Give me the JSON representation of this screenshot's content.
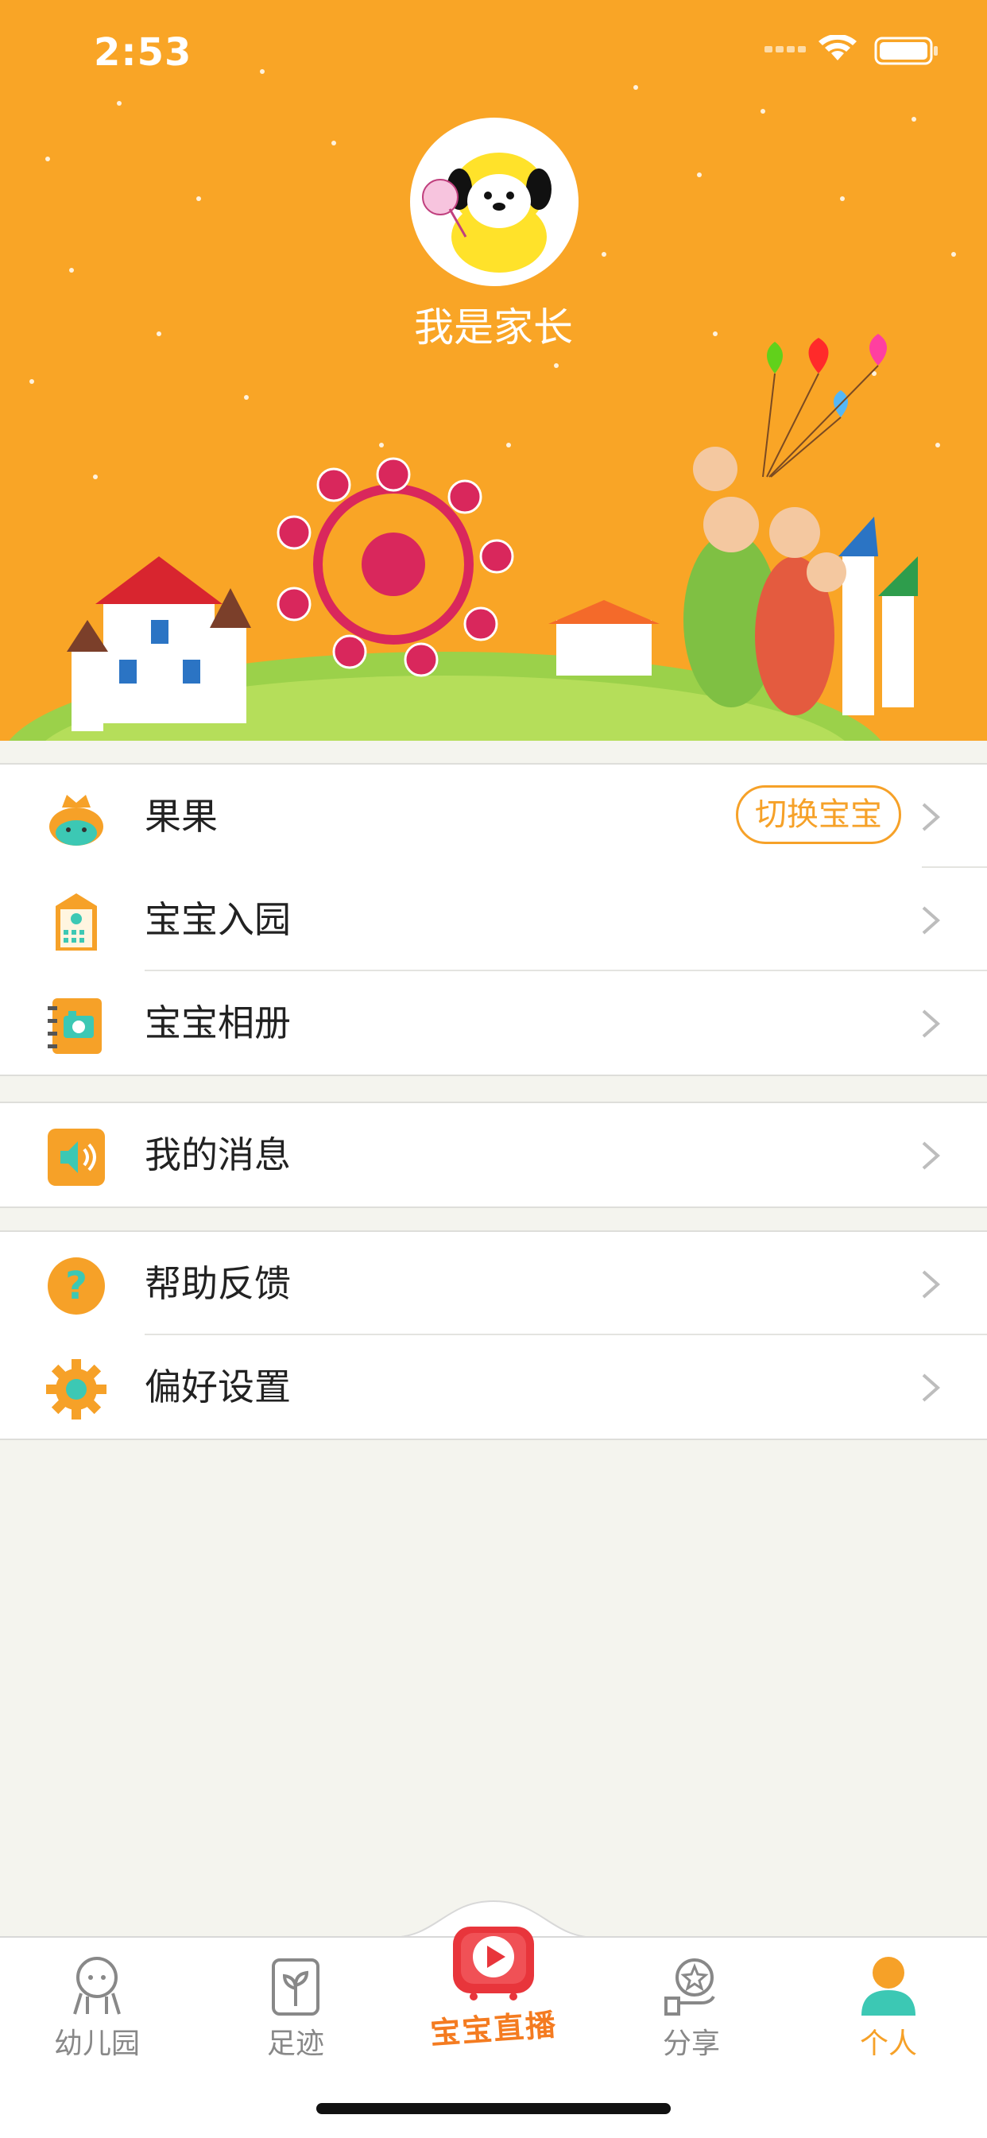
{
  "status_bar": {
    "time": "2:53"
  },
  "profile": {
    "username": "我是家长"
  },
  "menu": {
    "child": {
      "label": "果果",
      "switch_label": "切换宝宝"
    },
    "enroll": {
      "label": "宝宝入园"
    },
    "album": {
      "label": "宝宝相册"
    },
    "messages": {
      "label": "我的消息"
    },
    "help": {
      "label": "帮助反馈"
    },
    "settings": {
      "label": "偏好设置"
    }
  },
  "tabs": {
    "kindergarten": "幼儿园",
    "footprint": "足迹",
    "live": "宝宝直播",
    "share": "分享",
    "personal": "个人"
  },
  "colors": {
    "accent": "#f6a128",
    "header_bg": "#f9a526",
    "active_tab": "#f6a128"
  }
}
